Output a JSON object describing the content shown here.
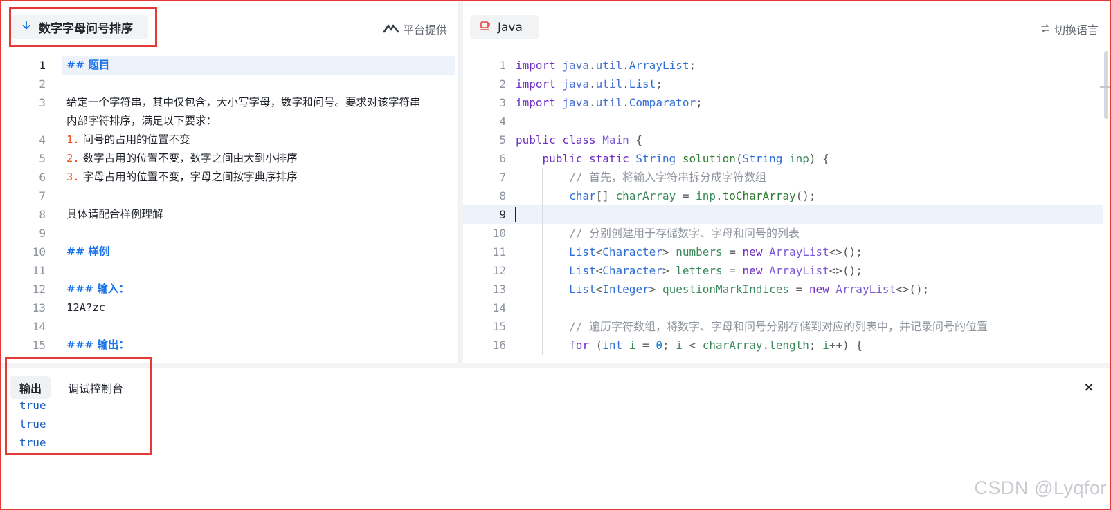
{
  "problem_panel": {
    "title": "数字字母问号排序",
    "provider": "平台提供",
    "lines": [
      {
        "n": "1",
        "text": "## 题目",
        "kind": "heading",
        "active": true
      },
      {
        "n": "2",
        "text": "",
        "kind": "text"
      },
      {
        "n": "3",
        "text": "给定一个字符串，其中仅包含，大小写字母，数字和问号。要求对该字符串",
        "text2": "内部字符排序，满足以下要求：",
        "kind": "wrap"
      },
      {
        "n": "4",
        "marker": "1.",
        "text": "问号的占用的位置不变",
        "kind": "list"
      },
      {
        "n": "5",
        "marker": "2.",
        "text": "数字占用的位置不变，数字之间由大到小排序",
        "kind": "list"
      },
      {
        "n": "6",
        "marker": "3.",
        "text": "字母占用的位置不变，字母之间按字典序排序",
        "kind": "list"
      },
      {
        "n": "7",
        "text": "",
        "kind": "text"
      },
      {
        "n": "8",
        "text": "具体请配合样例理解",
        "kind": "text"
      },
      {
        "n": "9",
        "text": "",
        "kind": "text"
      },
      {
        "n": "10",
        "text": "## 样例",
        "kind": "heading"
      },
      {
        "n": "11",
        "text": "",
        "kind": "text"
      },
      {
        "n": "12",
        "text": "### 输入：",
        "kind": "heading"
      },
      {
        "n": "13",
        "text": "12A?zc",
        "kind": "mono"
      },
      {
        "n": "14",
        "text": "",
        "kind": "text"
      },
      {
        "n": "15",
        "text": "### 输出：",
        "kind": "heading"
      }
    ]
  },
  "code_panel": {
    "language": "Java",
    "switch_label": "切换语言",
    "lines": [
      {
        "n": "1",
        "tokens": [
          [
            "kw",
            "import "
          ],
          [
            "pkg",
            "java"
          ],
          [
            "pn",
            "."
          ],
          [
            "pkg",
            "util"
          ],
          [
            "pn",
            "."
          ],
          [
            "typ",
            "ArrayList"
          ],
          [
            "pn",
            ";"
          ]
        ]
      },
      {
        "n": "2",
        "tokens": [
          [
            "kw",
            "import "
          ],
          [
            "pkg",
            "java"
          ],
          [
            "pn",
            "."
          ],
          [
            "pkg",
            "util"
          ],
          [
            "pn",
            "."
          ],
          [
            "typ",
            "List"
          ],
          [
            "pn",
            ";"
          ]
        ]
      },
      {
        "n": "3",
        "tokens": [
          [
            "kw",
            "import "
          ],
          [
            "pkg",
            "java"
          ],
          [
            "pn",
            "."
          ],
          [
            "pkg",
            "util"
          ],
          [
            "pn",
            "."
          ],
          [
            "typ",
            "Comparator"
          ],
          [
            "pn",
            ";"
          ]
        ]
      },
      {
        "n": "4",
        "tokens": []
      },
      {
        "n": "5",
        "tokens": [
          [
            "kw",
            "public class "
          ],
          [
            "cls",
            "Main"
          ],
          [
            "pn",
            " {"
          ]
        ]
      },
      {
        "n": "6",
        "tokens": [
          [
            "pn",
            "    "
          ],
          [
            "kw",
            "public static "
          ],
          [
            "typ",
            "String "
          ],
          [
            "fn",
            "solution"
          ],
          [
            "pn",
            "("
          ],
          [
            "typ",
            "String "
          ],
          [
            "vr",
            "inp"
          ],
          [
            "pn",
            ") {"
          ]
        ]
      },
      {
        "n": "7",
        "tokens": [
          [
            "pn",
            "        "
          ],
          [
            "cm",
            "// 首先，将输入字符串拆分成字符数组"
          ]
        ]
      },
      {
        "n": "8",
        "tokens": [
          [
            "pn",
            "        "
          ],
          [
            "typ",
            "char"
          ],
          [
            "pn",
            "[] "
          ],
          [
            "vr",
            "charArray"
          ],
          [
            "pn",
            " = "
          ],
          [
            "vr",
            "inp"
          ],
          [
            "pn",
            "."
          ],
          [
            "fn",
            "toCharArray"
          ],
          [
            "pn",
            "();"
          ]
        ]
      },
      {
        "n": "9",
        "tokens": [],
        "active": true
      },
      {
        "n": "10",
        "tokens": [
          [
            "pn",
            "        "
          ],
          [
            "cm",
            "// 分别创建用于存储数字、字母和问号的列表"
          ]
        ]
      },
      {
        "n": "11",
        "tokens": [
          [
            "pn",
            "        "
          ],
          [
            "typ",
            "List"
          ],
          [
            "pn",
            "<"
          ],
          [
            "typ",
            "Character"
          ],
          [
            "pn",
            "> "
          ],
          [
            "vr",
            "numbers"
          ],
          [
            "pn",
            " = "
          ],
          [
            "kw",
            "new "
          ],
          [
            "cls",
            "ArrayList"
          ],
          [
            "pn",
            "<>();"
          ]
        ]
      },
      {
        "n": "12",
        "tokens": [
          [
            "pn",
            "        "
          ],
          [
            "typ",
            "List"
          ],
          [
            "pn",
            "<"
          ],
          [
            "typ",
            "Character"
          ],
          [
            "pn",
            "> "
          ],
          [
            "vr",
            "letters"
          ],
          [
            "pn",
            " = "
          ],
          [
            "kw",
            "new "
          ],
          [
            "cls",
            "ArrayList"
          ],
          [
            "pn",
            "<>();"
          ]
        ]
      },
      {
        "n": "13",
        "tokens": [
          [
            "pn",
            "        "
          ],
          [
            "typ",
            "List"
          ],
          [
            "pn",
            "<"
          ],
          [
            "typ",
            "Integer"
          ],
          [
            "pn",
            "> "
          ],
          [
            "vr",
            "questionMarkIndices"
          ],
          [
            "pn",
            " = "
          ],
          [
            "kw",
            "new "
          ],
          [
            "cls",
            "ArrayList"
          ],
          [
            "pn",
            "<>();"
          ]
        ]
      },
      {
        "n": "14",
        "tokens": []
      },
      {
        "n": "15",
        "tokens": [
          [
            "pn",
            "        "
          ],
          [
            "cm",
            "// 遍历字符数组，将数字、字母和问号分别存储到对应的列表中，并记录问号的位置"
          ]
        ]
      },
      {
        "n": "16",
        "tokens": [
          [
            "pn",
            "        "
          ],
          [
            "kw",
            "for "
          ],
          [
            "pn",
            "("
          ],
          [
            "typ",
            "int "
          ],
          [
            "vr",
            "i"
          ],
          [
            "pn",
            " = "
          ],
          [
            "num",
            "0"
          ],
          [
            "pn",
            "; "
          ],
          [
            "vr",
            "i"
          ],
          [
            "pn",
            " < "
          ],
          [
            "vr",
            "charArray"
          ],
          [
            "pn",
            "."
          ],
          [
            "vr",
            "length"
          ],
          [
            "pn",
            "; "
          ],
          [
            "vr",
            "i"
          ],
          [
            "pn",
            "++) {"
          ]
        ]
      }
    ]
  },
  "console": {
    "tabs": [
      {
        "label": "输出",
        "active": true
      },
      {
        "label": "调试控制台",
        "active": false
      }
    ],
    "output": [
      "true",
      "true",
      "true"
    ],
    "close_symbol": "×"
  },
  "watermark": "CSDN @Lyqfor",
  "colors": {
    "highlight": "#e53935",
    "accent": "#1a73e8",
    "list_marker": "#f4511e"
  }
}
